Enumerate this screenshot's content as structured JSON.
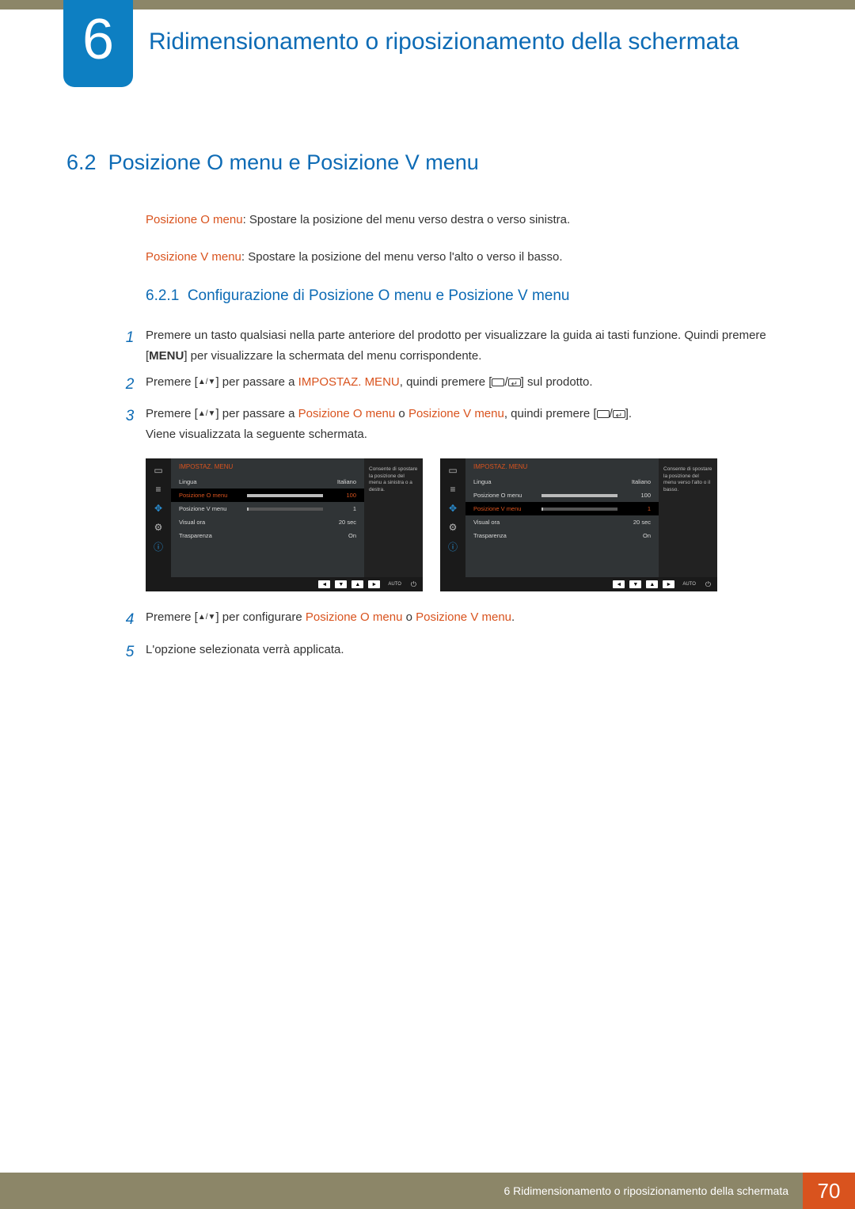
{
  "chapter": {
    "number": "6",
    "title": "Ridimensionamento o riposizionamento della schermata"
  },
  "section": {
    "number": "6.2",
    "title": "Posizione O menu e Posizione V menu"
  },
  "descriptions": [
    {
      "label": "Posizione O menu",
      "text": ": Spostare la posizione del menu verso destra o verso sinistra."
    },
    {
      "label": "Posizione V menu",
      "text": ": Spostare la posizione del menu verso l'alto o verso il basso."
    }
  ],
  "subsection": {
    "number": "6.2.1",
    "title": "Configurazione di Posizione O menu e Posizione V menu"
  },
  "steps": {
    "s1a": "Premere un tasto qualsiasi nella parte anteriore del prodotto per visualizzare la guida ai tasti funzione. Quindi premere [",
    "s1_menu": "MENU",
    "s1b": "] per visualizzare la schermata del menu corrispondente.",
    "s2a": "Premere [",
    "s2b": "] per passare a ",
    "s2_hl": "IMPOSTAZ. MENU",
    "s2c": ", quindi premere [",
    "s2d": "] sul prodotto.",
    "s3a": "Premere [",
    "s3b": "] per passare a ",
    "s3_hl1": "Posizione O menu",
    "s3_o": " o ",
    "s3_hl2": "Posizione V menu",
    "s3c": ", quindi premere [",
    "s3d": "].",
    "s3e": "Viene visualizzata la seguente schermata.",
    "s4a": "Premere [",
    "s4b": "] per configurare ",
    "s4_hl1": "Posizione O menu",
    "s4_o": " o ",
    "s4_hl2": "Posizione V menu",
    "s4c": ".",
    "s5": "L'opzione selezionata verrà applicata."
  },
  "osd": {
    "header": "IMPOSTAZ. MENU",
    "rows": [
      {
        "label": "Lingua",
        "value": "Italiano",
        "hasSlider": false
      },
      {
        "label": "Posizione O menu",
        "value": "100",
        "hasSlider": true,
        "fill": 100
      },
      {
        "label": "Posizione V menu",
        "value": "1",
        "hasSlider": true,
        "fill": 2
      },
      {
        "label": "Visual ora",
        "value": "20 sec",
        "hasSlider": false
      },
      {
        "label": "Trasparenza",
        "value": "On",
        "hasSlider": false
      }
    ],
    "info1": "Consente di spostare la posizione del menu a sinistra o a destra.",
    "info2": "Consente di spostare la posizione del menu verso l'alto o il basso.",
    "auto": "AUTO"
  },
  "footer": {
    "text": "6 Ridimensionamento o riposizionamento della schermata",
    "page": "70"
  }
}
